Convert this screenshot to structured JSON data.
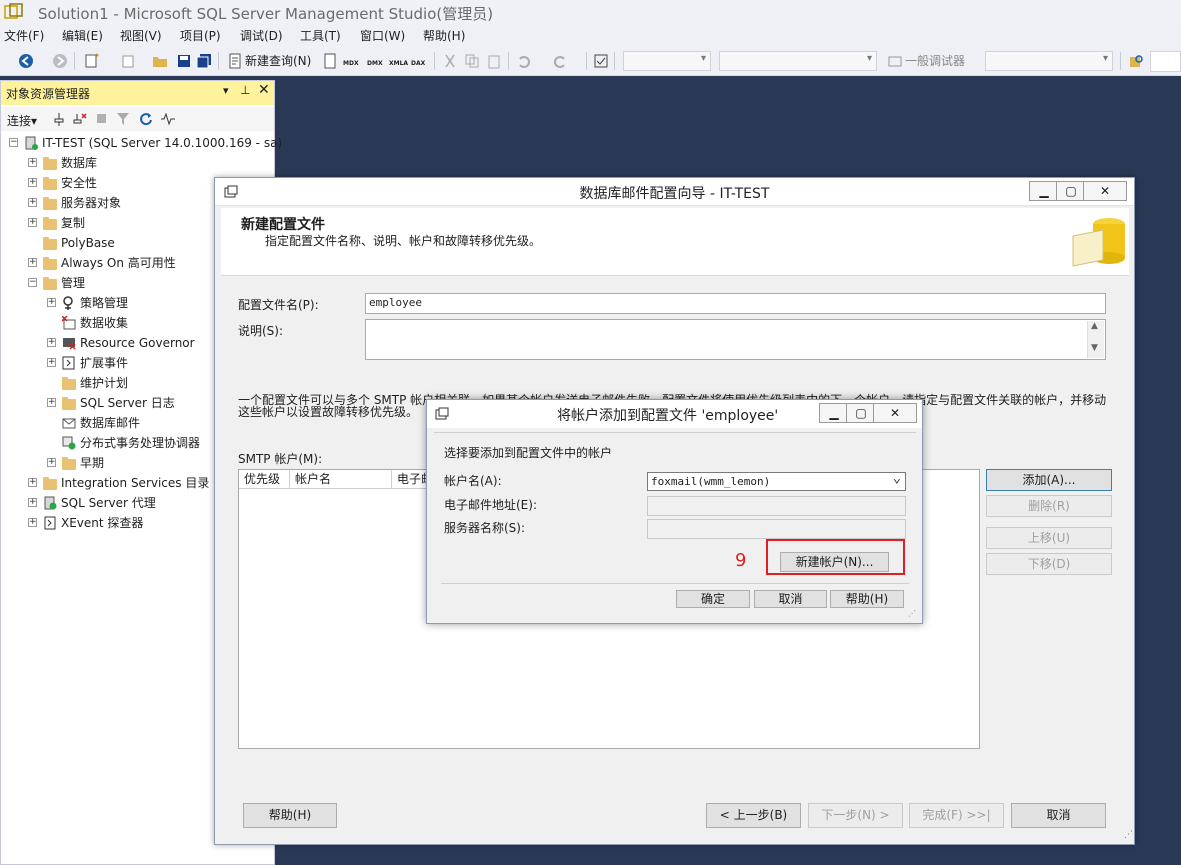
{
  "window": {
    "title": "Solution1 - Microsoft SQL Server Management Studio(管理员)"
  },
  "menu": [
    "文件(F)",
    "编辑(E)",
    "视图(V)",
    "项目(P)",
    "调试(D)",
    "工具(T)",
    "窗口(W)",
    "帮助(H)"
  ],
  "toolbar": {
    "new_query": "新建查询(N)",
    "mini_labels": [
      "MDX",
      "DMX",
      "XMLA",
      "DAX"
    ],
    "debugger_label": "一般调试器"
  },
  "object_explorer": {
    "title": "对象资源管理器",
    "connect_label": "连接",
    "tree": [
      {
        "label": "IT-TEST (SQL Server 14.0.1000.169 - sa)",
        "level": 0,
        "expander": "−",
        "icon": "server-icon"
      },
      {
        "label": "数据库",
        "level": 1,
        "expander": "+",
        "icon": "folder-icon"
      },
      {
        "label": "安全性",
        "level": 1,
        "expander": "+",
        "icon": "folder-icon"
      },
      {
        "label": "服务器对象",
        "level": 1,
        "expander": "+",
        "icon": "folder-icon"
      },
      {
        "label": "复制",
        "level": 1,
        "expander": "+",
        "icon": "folder-icon"
      },
      {
        "label": "PolyBase",
        "level": 1,
        "expander": "",
        "icon": "folder-icon"
      },
      {
        "label": "Always On 高可用性",
        "level": 1,
        "expander": "+",
        "icon": "folder-icon"
      },
      {
        "label": "管理",
        "level": 1,
        "expander": "−",
        "icon": "folder-icon"
      },
      {
        "label": "策略管理",
        "level": 2,
        "expander": "+",
        "icon": "policy-icon"
      },
      {
        "label": "数据收集",
        "level": 2,
        "expander": "",
        "icon": "data-collection-icon"
      },
      {
        "label": "Resource Governor",
        "level": 2,
        "expander": "+",
        "icon": "resource-governor-icon"
      },
      {
        "label": "扩展事件",
        "level": 2,
        "expander": "+",
        "icon": "extended-events-icon"
      },
      {
        "label": "维护计划",
        "level": 2,
        "expander": "",
        "icon": "folder-icon"
      },
      {
        "label": "SQL Server 日志",
        "level": 2,
        "expander": "+",
        "icon": "folder-icon"
      },
      {
        "label": "数据库邮件",
        "level": 2,
        "expander": "",
        "icon": "database-mail-icon"
      },
      {
        "label": "分布式事务处理协调器",
        "level": 2,
        "expander": "",
        "icon": "dtc-icon"
      },
      {
        "label": "早期",
        "level": 2,
        "expander": "+",
        "icon": "folder-icon"
      },
      {
        "label": "Integration Services 目录",
        "level": 1,
        "expander": "+",
        "icon": "folder-icon"
      },
      {
        "label": "SQL Server 代理",
        "level": 1,
        "expander": "+",
        "icon": "agent-icon"
      },
      {
        "label": "XEvent 探查器",
        "level": 1,
        "expander": "+",
        "icon": "xevent-icon"
      }
    ]
  },
  "wizard": {
    "title": "数据库邮件配置向导 - IT-TEST",
    "header_title": "新建配置文件",
    "header_subtitle": "指定配置文件名称、说明、帐户和故障转移优先级。",
    "profile_name_label": "配置文件名(P):",
    "profile_name_value": "employee",
    "description_label": "说明(S):",
    "description_value": "",
    "info_line1": "一个配置文件可以与多个 SMTP 帐户相关联。如果某个帐户发送电子邮件失败，配置文件将使用优先级列表中的下一个帐户。请指定与配置文件关联的帐户，并移动",
    "info_line2": "这些帐户以设置故障转移优先级。",
    "smtp_label": "SMTP 帐户(M):",
    "grid_columns": [
      "优先级",
      "帐户名",
      "电子邮件地址"
    ],
    "buttons": {
      "add": "添加(A)...",
      "remove": "删除(R)",
      "move_up": "上移(U)",
      "move_down": "下移(D)",
      "help": "帮助(H)",
      "back": "< 上一步(B)",
      "next": "下一步(N) >",
      "finish": "完成(F) >>|",
      "cancel": "取消"
    }
  },
  "dialog": {
    "title": "将帐户添加到配置文件 'employee'",
    "prompt": "选择要添加到配置文件中的帐户",
    "account_label": "帐户名(A):",
    "account_value": "foxmail(wmm_lemon)",
    "email_label": "电子邮件地址(E):",
    "email_value": "",
    "server_label": "服务器名称(S):",
    "server_value": "",
    "new_account_button": "新建帐户(N)...",
    "ok_button": "确定",
    "cancel_button": "取消",
    "help_button": "帮助(H)"
  },
  "annotation": {
    "step_number": "9",
    "highlight_color": "#e02020"
  },
  "colors": {
    "oe_header": "#fff29d",
    "desktop": "#293955"
  }
}
